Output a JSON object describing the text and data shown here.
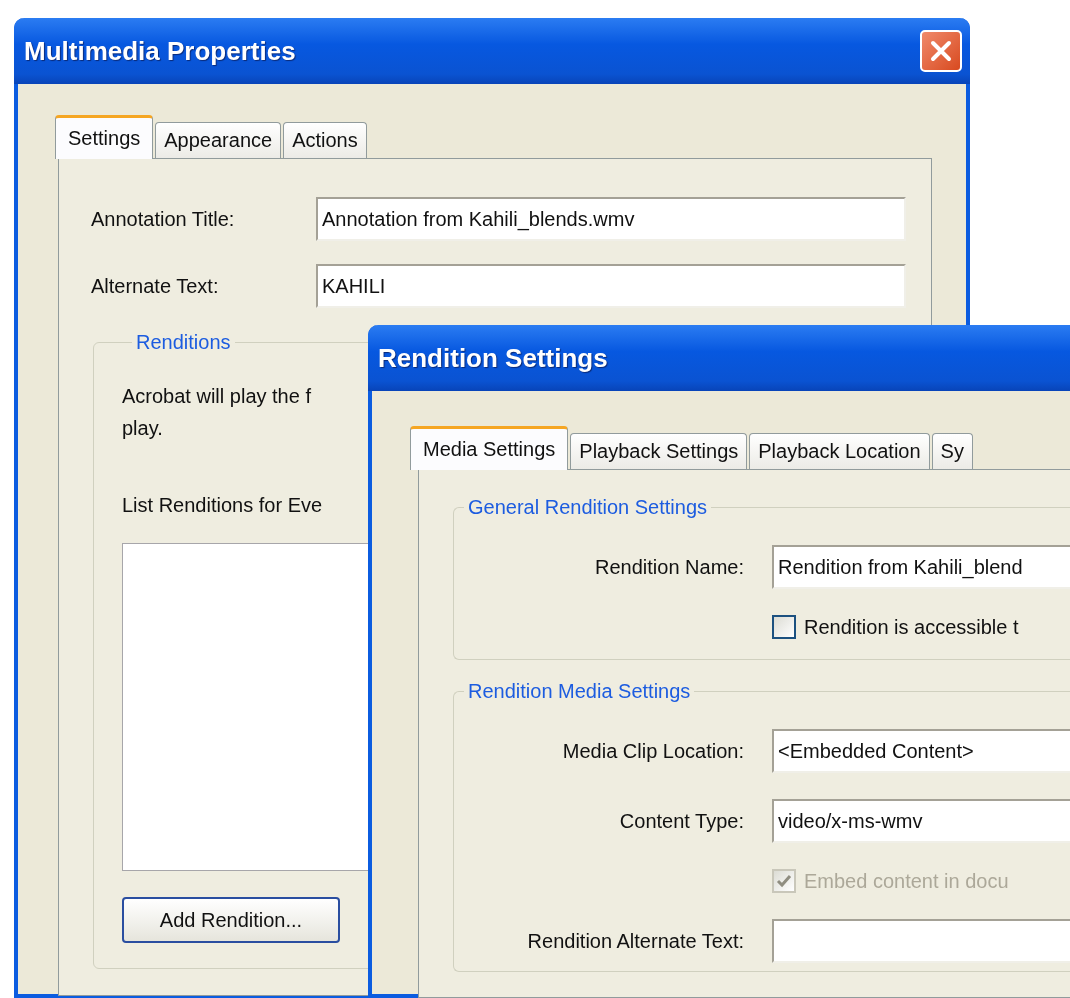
{
  "main_window": {
    "title": "Multimedia Properties",
    "tabs": [
      {
        "label": "Settings",
        "selected": true
      },
      {
        "label": "Appearance",
        "selected": false
      },
      {
        "label": "Actions",
        "selected": false
      }
    ],
    "fields": [
      {
        "label": "Annotation Title:",
        "value": "Annotation from Kahili_blends.wmv"
      },
      {
        "label": "Alternate Text:",
        "value": "KAHILI"
      }
    ],
    "renditions": {
      "title": "Renditions",
      "description": "Acrobat will play the f\nplay.",
      "list_label": "List Renditions for Eve",
      "button": "Add Rendition..."
    }
  },
  "dialog": {
    "title": "Rendition Settings",
    "tabs": [
      {
        "label": "Media Settings",
        "selected": true
      },
      {
        "label": "Playback Settings",
        "selected": false
      },
      {
        "label": "Playback Location",
        "selected": false
      },
      {
        "label": "Sy",
        "selected": false
      }
    ],
    "groups": [
      {
        "title": "General Rendition Settings",
        "rows": [
          {
            "kind": "field",
            "label": "Rendition Name:",
            "value": "Rendition from Kahili_blend"
          },
          {
            "kind": "checkbox",
            "label": "Rendition is accessible t",
            "checked": false,
            "disabled": false
          }
        ]
      },
      {
        "title": "Rendition Media Settings",
        "rows": [
          {
            "kind": "field",
            "label": "Media Clip Location:",
            "value": "<Embedded Content>"
          },
          {
            "kind": "field",
            "label": "Content Type:",
            "value": "video/x-ms-wmv"
          },
          {
            "kind": "checkbox",
            "label": "Embed content in docu",
            "checked": true,
            "disabled": true
          },
          {
            "kind": "field",
            "label": "Rendition Alternate Text:"
          }
        ]
      }
    ]
  }
}
